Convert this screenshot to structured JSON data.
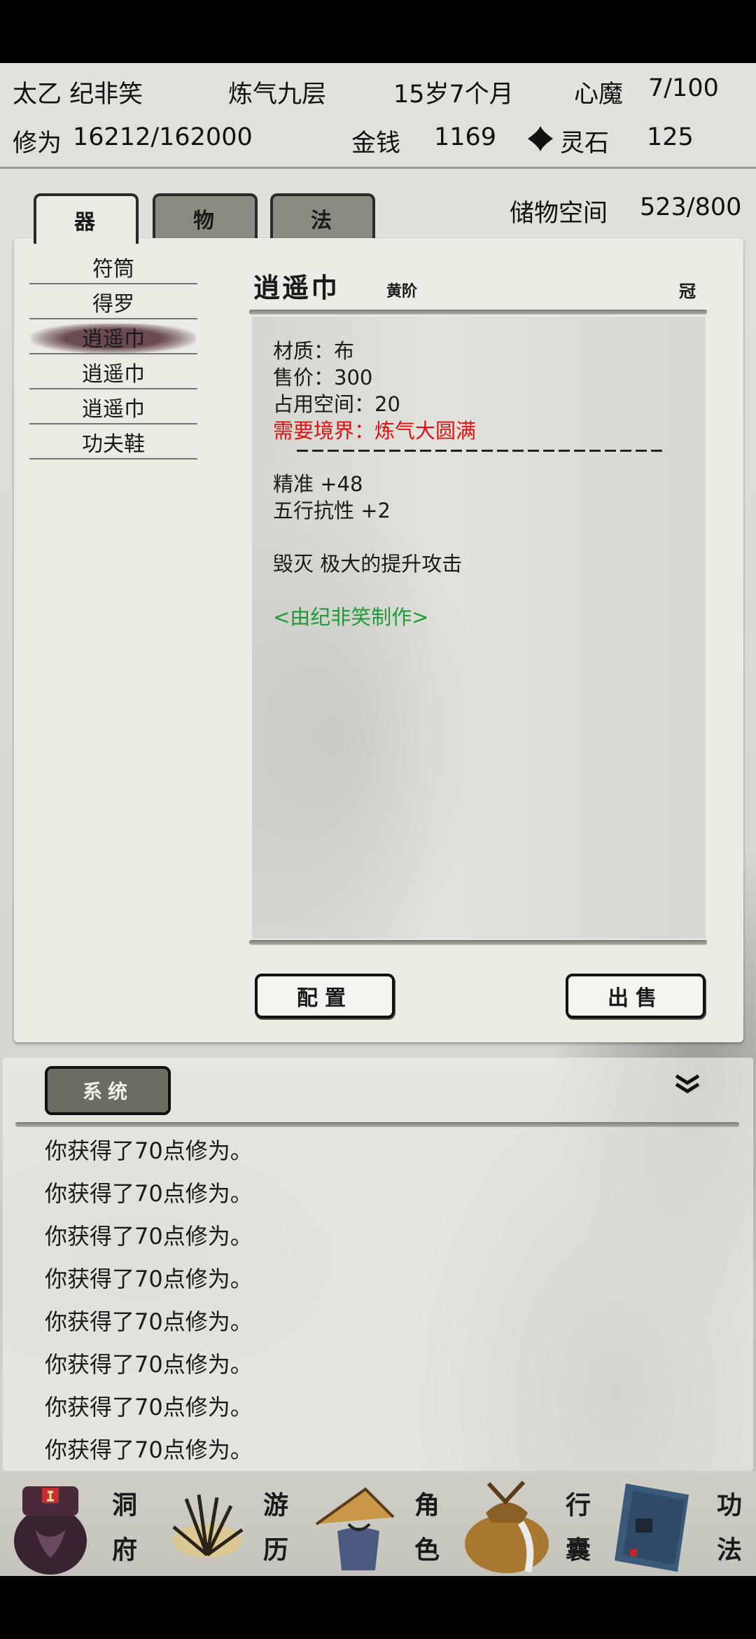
{
  "header": {
    "name": "太乙 纪非笑",
    "realm": "炼气九层",
    "age": "15岁7个月",
    "heart_demon_label": "心魔",
    "heart_demon_value": "7/100",
    "cultivation_label": "修为",
    "cultivation_value": "16212/162000",
    "money_label": "金钱",
    "money_value": "1169",
    "spirit_stone_label": "灵石",
    "spirit_stone_value": "125"
  },
  "tabs": [
    {
      "label": "器",
      "active": true
    },
    {
      "label": "物",
      "active": false
    },
    {
      "label": "法",
      "active": false
    }
  ],
  "storage": {
    "label": "储物空间",
    "value": "523/800"
  },
  "item_list": [
    {
      "name": "符筒",
      "selected": false
    },
    {
      "name": "得罗",
      "selected": false
    },
    {
      "name": "逍遥巾",
      "selected": true
    },
    {
      "name": "逍遥巾",
      "selected": false
    },
    {
      "name": "逍遥巾",
      "selected": false
    },
    {
      "name": "功夫鞋",
      "selected": false
    }
  ],
  "detail": {
    "title": "逍遥巾",
    "grade": "黄阶",
    "slot": "冠",
    "material": "材质：布",
    "price": "售价：300",
    "space": "占用空间：20",
    "requirement": "需要境界：炼气大圆满",
    "divider": "————————————————————————",
    "stat1": "精准 +48",
    "stat2": "五行抗性 +2",
    "effect": "毁灭 极大的提升攻击",
    "maker": "<由纪非笑制作>",
    "requirement_color": "#e01010",
    "maker_color": "#1f9a3a"
  },
  "buttons": {
    "equip": "配置",
    "sell": "出售"
  },
  "log": {
    "tab_label": "系统",
    "lines": [
      "你获得了70点修为。",
      "你获得了70点修为。",
      "你获得了70点修为。",
      "你获得了70点修为。",
      "你获得了70点修为。",
      "你获得了70点修为。",
      "你获得了70点修为。",
      "你获得了70点修为。"
    ]
  },
  "nav": [
    {
      "label": "洞府",
      "icon": "cave-icon"
    },
    {
      "label": "游历",
      "icon": "travel-icon"
    },
    {
      "label": "角色",
      "icon": "character-icon"
    },
    {
      "label": "行囊",
      "icon": "bag-icon"
    },
    {
      "label": "功法",
      "icon": "scroll-book-icon"
    }
  ]
}
